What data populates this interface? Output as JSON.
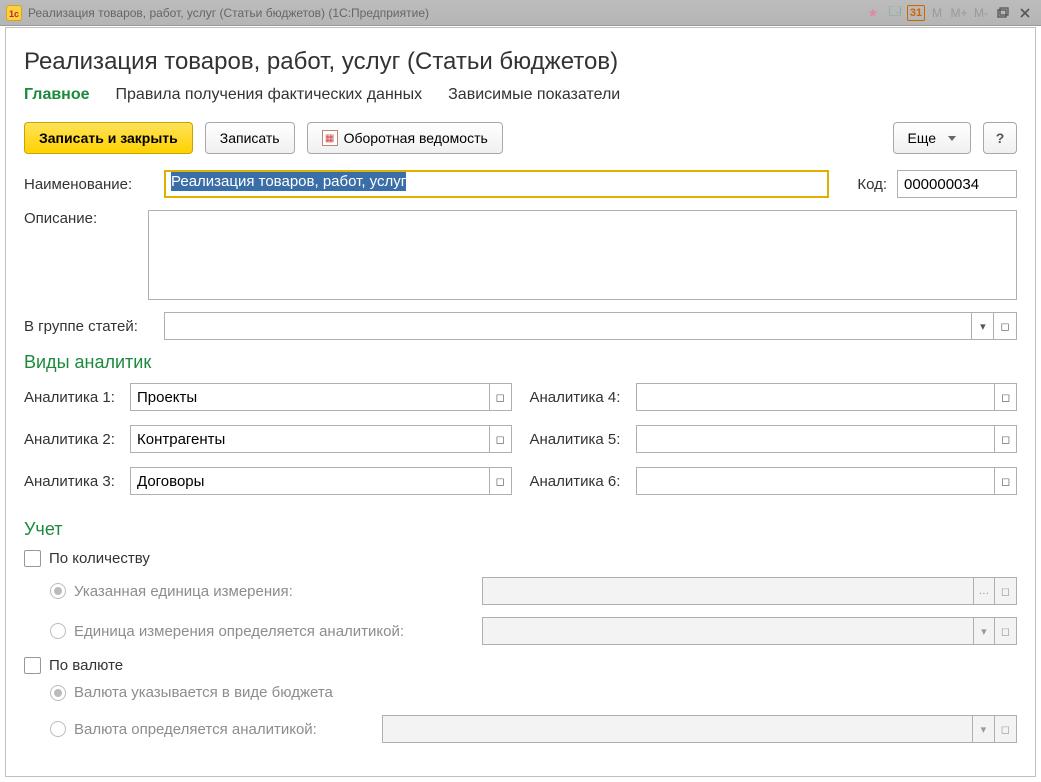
{
  "window": {
    "title": "Реализация товаров, работ, услуг (Статьи бюджетов)  (1С:Предприятие)",
    "icon_text": "1c"
  },
  "header": {
    "title": "Реализация товаров, работ, услуг (Статьи бюджетов)"
  },
  "tabs": {
    "main": "Главное",
    "rules": "Правила получения фактических данных",
    "dependents": "Зависимые показатели"
  },
  "toolbar": {
    "save_close": "Записать и закрыть",
    "save": "Записать",
    "turnover": "Оборотная ведомость",
    "more": "Еще",
    "help": "?"
  },
  "fields": {
    "name_label": "Наименование:",
    "name_value": "Реализация товаров, работ, услуг",
    "code_label": "Код:",
    "code_value": "000000034",
    "desc_label": "Описание:",
    "desc_value": "",
    "group_label": "В группе статей:",
    "group_value": ""
  },
  "analytics": {
    "title": "Виды аналитик",
    "items": [
      {
        "label": "Аналитика 1:",
        "value": "Проекты"
      },
      {
        "label": "Аналитика 2:",
        "value": "Контрагенты"
      },
      {
        "label": "Аналитика 3:",
        "value": "Договоры"
      },
      {
        "label": "Аналитика 4:",
        "value": ""
      },
      {
        "label": "Аналитика 5:",
        "value": ""
      },
      {
        "label": "Аналитика 6:",
        "value": ""
      }
    ]
  },
  "accounting": {
    "title": "Учет",
    "by_qty": "По количеству",
    "unit_fixed": "Указанная единица измерения:",
    "unit_by_analytic": "Единица измерения определяется аналитикой:",
    "by_currency": "По валюте",
    "currency_in_budget": "Валюта указывается в виде бюджета",
    "currency_by_analytic": "Валюта определяется аналитикой:"
  }
}
